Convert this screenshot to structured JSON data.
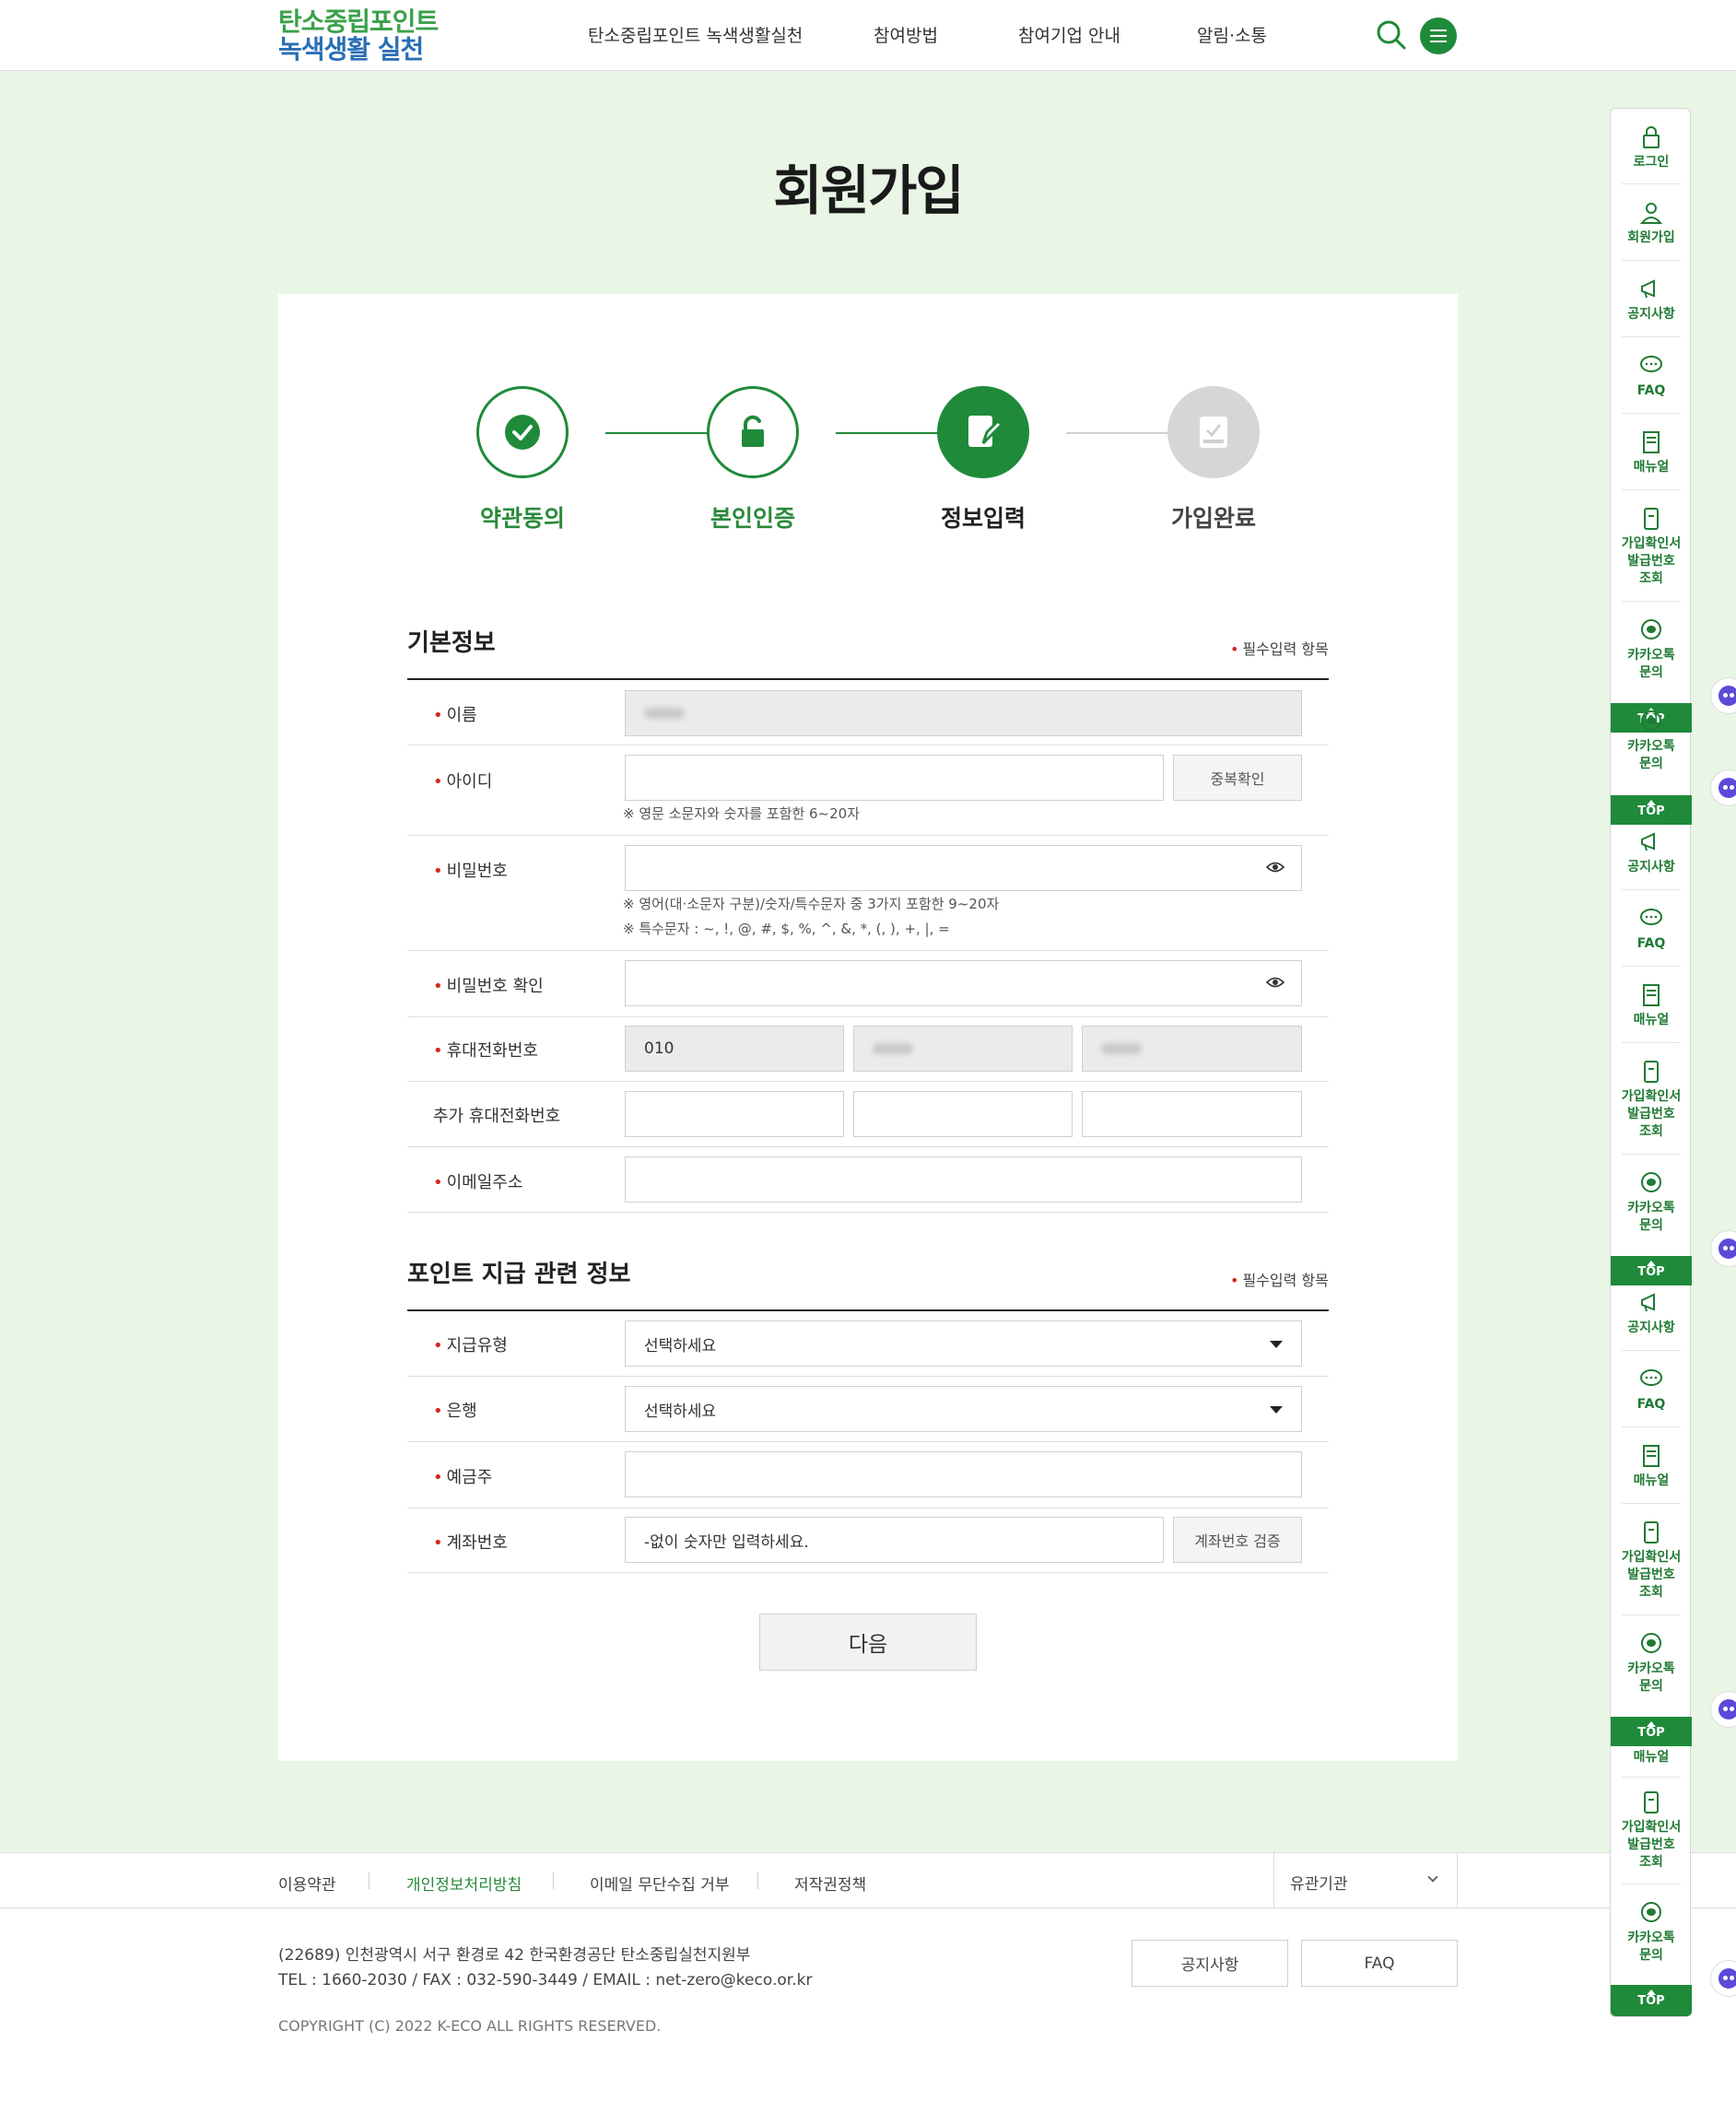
{
  "header": {
    "logo_line1": "탄소중립포인트",
    "logo_line2": "녹색생활 실천",
    "nav": [
      "탄소중립포인트 녹색생활실천",
      "참여방법",
      "참여기업 안내",
      "알림·소통"
    ]
  },
  "page": {
    "title": "회원가입"
  },
  "steps": [
    {
      "label": "약관동의",
      "state": "done"
    },
    {
      "label": "본인인증",
      "state": "done"
    },
    {
      "label": "정보입력",
      "state": "current"
    },
    {
      "label": "가입완료",
      "state": "todo"
    }
  ],
  "basic": {
    "title": "기본정보",
    "required_note": "필수입력 항목",
    "name_label": "이름",
    "id_label": "아이디",
    "id_check_button": "중복확인",
    "id_hint": "※ 영문 소문자와 숫자를 포함한 6~20자",
    "pw_label": "비밀번호",
    "pw_hint1": "※ 영어(대·소문자 구분)/숫자/특수문자 중 3가지 포함한 9~20자",
    "pw_hint2": "※ 특수문자 : ~, !, @, #, $, %, ^, &, *, (, ), +, |, =",
    "pw_confirm_label": "비밀번호 확인",
    "phone_label": "휴대전화번호",
    "phone_prefix": "010",
    "extra_phone_label": "추가 휴대전화번호",
    "email_label": "이메일주소"
  },
  "point": {
    "title": "포인트 지급 관련 정보",
    "required_note": "필수입력 항목",
    "pay_type_label": "지급유형",
    "pay_type_value": "선택하세요",
    "bank_label": "은행",
    "bank_value": "선택하세요",
    "holder_label": "예금주",
    "account_label": "계좌번호",
    "account_placeholder": "-없이 숫자만 입력하세요.",
    "account_verify_button": "계좌번호 검증"
  },
  "next_button": "다음",
  "footer_nav": {
    "items": [
      "이용약관",
      "개인정보처리방침",
      "이메일 무단수집 거부",
      "저작권정책"
    ],
    "related": "유관기관"
  },
  "footer": {
    "address": "(22689) 인천광역시 서구 환경로 42 한국환경공단 탄소중립실천지원부",
    "contact": "TEL : 1660-2030 / FAX : 032-590-3449 / EMAIL : net-zero@keco.or.kr",
    "copyright": "COPYRIGHT (C) 2022 K-ECO ALL RIGHTS RESERVED.",
    "buttons": [
      "공지사항",
      "FAQ"
    ]
  },
  "quick_menu": {
    "login": "로그인",
    "join": "회원가입",
    "notice": "공지사항",
    "faq": "FAQ",
    "manual": "매뉴얼",
    "cert_lines": [
      "가입확인서",
      "발급번호",
      "조회"
    ],
    "kakao_lines": [
      "카카오톡",
      "문의"
    ],
    "top": "TOP"
  },
  "colors": {
    "brand_green": "#1f8a3a",
    "bg_green": "#e9f6e6",
    "required_red": "#d4261e"
  }
}
